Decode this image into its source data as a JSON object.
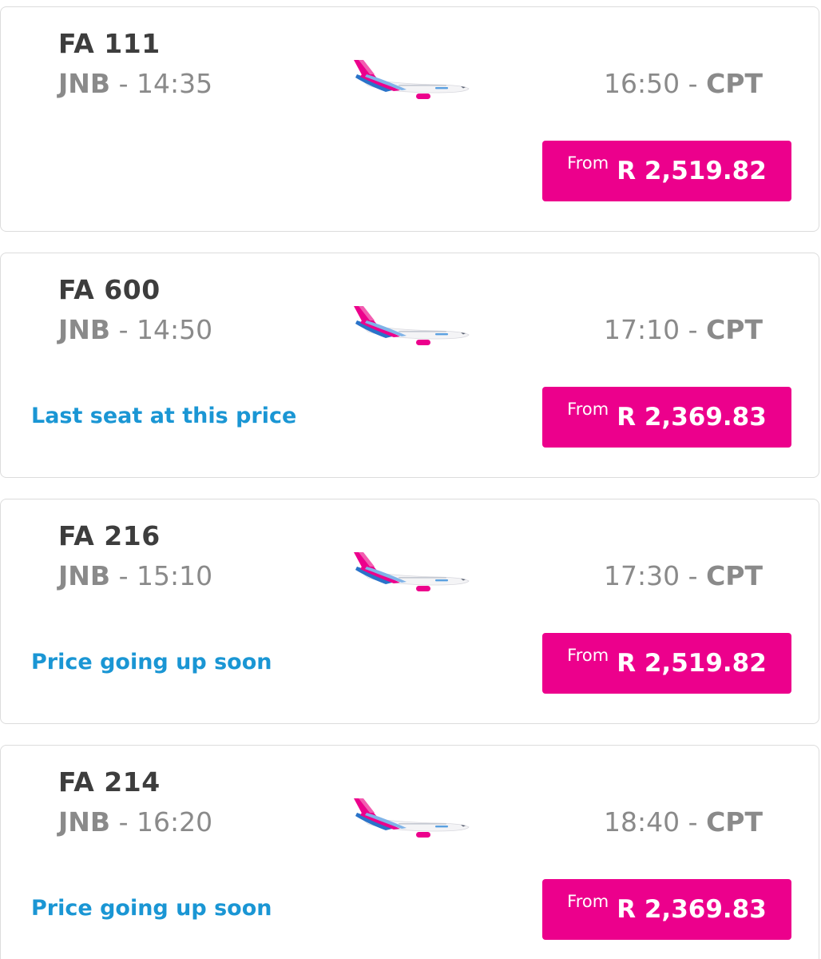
{
  "colors": {
    "accent": "#ec008c",
    "promo_text": "#1a96d4",
    "flight_number": "#3d3d3d",
    "secondary_text": "#8a8a8a"
  },
  "flights": [
    {
      "flight_number": "FA 111",
      "origin": "JNB",
      "departure": "14:35",
      "arrival": "16:50",
      "destination": "CPT",
      "promo": "",
      "price_prefix": "From",
      "price": "R 2,519.82",
      "aircraft_icon": "plane-icon"
    },
    {
      "flight_number": "FA 600",
      "origin": "JNB",
      "departure": "14:50",
      "arrival": "17:10",
      "destination": "CPT",
      "promo": "Last seat at this price",
      "price_prefix": "From",
      "price": "R 2,369.83",
      "aircraft_icon": "plane-icon"
    },
    {
      "flight_number": "FA 216",
      "origin": "JNB",
      "departure": "15:10",
      "arrival": "17:30",
      "destination": "CPT",
      "promo": "Price going up soon",
      "price_prefix": "From",
      "price": "R 2,519.82",
      "aircraft_icon": "plane-icon"
    },
    {
      "flight_number": "FA 214",
      "origin": "JNB",
      "departure": "16:20",
      "arrival": "18:40",
      "destination": "CPT",
      "promo": "Price going up soon",
      "price_prefix": "From",
      "price": "R 2,369.83",
      "aircraft_icon": "plane-icon"
    }
  ],
  "separator": "-"
}
